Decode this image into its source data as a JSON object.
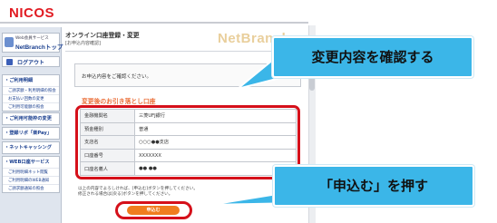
{
  "header": {
    "logo": "NICOS"
  },
  "sidebar": {
    "brand_small": "Web会員サービス",
    "brand_big": "NetBranchトップ",
    "logout": "ログアウト",
    "sections": [
      {
        "title": "・ご利用明細",
        "items": [
          "ご請求額・利用明細の照会",
          "お支払い回数の変更",
          "ご利用可能額の照会"
        ]
      },
      {
        "title": "・ご利用可能枠の変更",
        "items": []
      },
      {
        "title": "・登録リボ「楽Pay」",
        "items": []
      },
      {
        "title": "・ネットキャッシング",
        "items": []
      },
      {
        "title": "・WEB口座サービス",
        "items": [
          "ご利用明細ネット閲覧",
          "ご利用明細のWEB通知",
          "ご請求額通知の照会"
        ]
      }
    ]
  },
  "main": {
    "title": "オンライン口座登録・変更",
    "subtitle": "[お申込内容確認]",
    "watermark": "NetBranch",
    "notice": "お申込内容をご確認ください。",
    "confirm_heading": "変更後のお引き落とし口座",
    "rows": [
      {
        "label": "金融機関名",
        "value": "三菱UFJ銀行"
      },
      {
        "label": "預金種別",
        "value": "普通"
      },
      {
        "label": "支店名",
        "value": "○○○●●支店"
      },
      {
        "label": "口座番号",
        "value": "XXXXXXX"
      },
      {
        "label": "口座名義人",
        "value": "●● ●●"
      }
    ],
    "footnote_1": "以上の内容でよろしければ、[申込む]ボタンを押してください。",
    "footnote_2": "修正される場合は[戻る]ボタンを押してください。",
    "apply_button": "申込む"
  },
  "callouts": {
    "confirm": "変更内容を確認する",
    "press": "「申込む」を押す"
  },
  "colors": {
    "callout": "#3bb6e8",
    "highlight": "#d5101a",
    "apply_button": "#f07d1e",
    "logo": "#e11b22"
  }
}
